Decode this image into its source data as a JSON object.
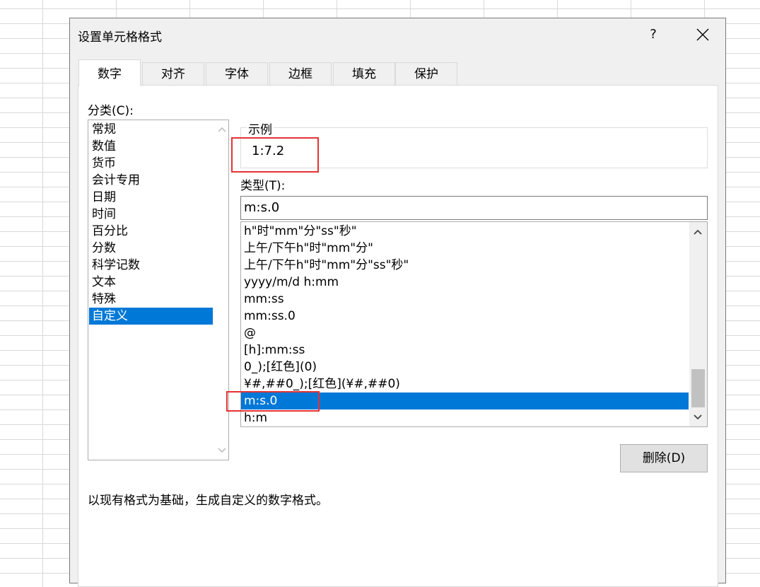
{
  "dialog": {
    "title": "设置单元格格式",
    "help": "?"
  },
  "tabs": [
    "数字",
    "对齐",
    "字体",
    "边框",
    "填充",
    "保护"
  ],
  "category_label": "分类(C):",
  "categories": [
    "常规",
    "数值",
    "货币",
    "会计专用",
    "日期",
    "时间",
    "百分比",
    "分数",
    "科学记数",
    "文本",
    "特殊",
    "自定义"
  ],
  "sample": {
    "legend": "示例",
    "value": "1:7.2"
  },
  "type_label": "类型(T):",
  "type_input": "m:s.0",
  "type_list": [
    "h\"时\"mm\"分\"ss\"秒\"",
    "上午/下午h\"时\"mm\"分\"",
    "上午/下午h\"时\"mm\"分\"ss\"秒\"",
    "yyyy/m/d h:mm",
    "mm:ss",
    "mm:ss.0",
    "@",
    "[h]:mm:ss",
    "0_);[红色](0)",
    "¥#,##0_);[红色](¥#,##0)",
    "m:s.0",
    "h:m"
  ],
  "delete_label": "删除(D)",
  "description": "以现有格式为基础，生成自定义的数字格式。",
  "colors": {
    "selection": "#0078d7",
    "highlight": "#e53333"
  }
}
